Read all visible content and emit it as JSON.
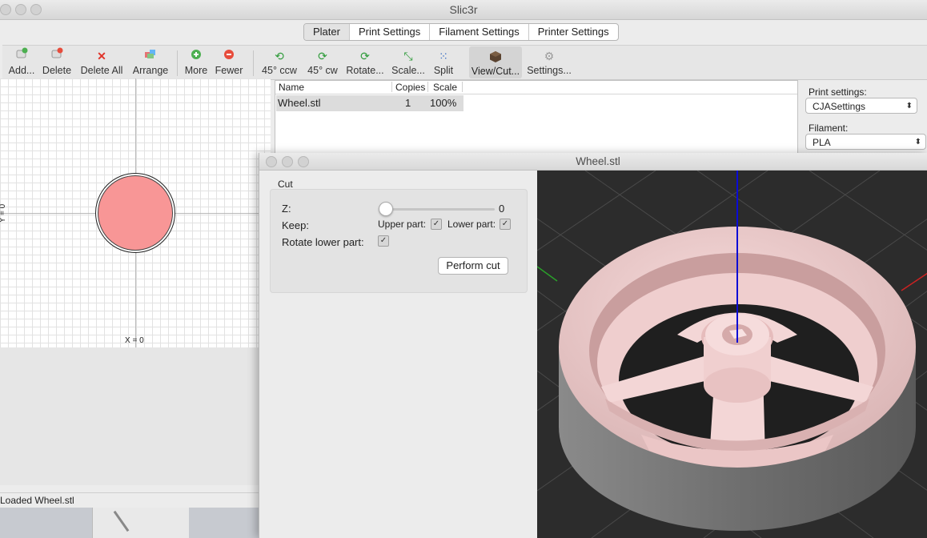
{
  "app": {
    "title": "Slic3r"
  },
  "tabs": [
    "Plater",
    "Print Settings",
    "Filament Settings",
    "Printer Settings"
  ],
  "toolbar": {
    "add": "Add...",
    "delete": "Delete",
    "delete_all": "Delete All",
    "arrange": "Arrange",
    "more": "More",
    "fewer": "Fewer",
    "rot_ccw": "45° ccw",
    "rot_cw": "45° cw",
    "rotate": "Rotate...",
    "scale": "Scale...",
    "split": "Split",
    "view_cut": "View/Cut...",
    "settings": "Settings..."
  },
  "plater": {
    "y_label": "Y = 0",
    "x_label": "X = 0"
  },
  "objects": {
    "headers": {
      "name": "Name",
      "copies": "Copies",
      "scale": "Scale"
    },
    "rows": [
      {
        "name": "Wheel.stl",
        "copies": "1",
        "scale": "100%"
      }
    ]
  },
  "settings": {
    "print_label": "Print settings:",
    "print_value": "CJASettings",
    "filament_label": "Filament:",
    "filament_value": "PLA"
  },
  "status": {
    "text": "Loaded Wheel.stl"
  },
  "dialog": {
    "title": "Wheel.stl",
    "group": "Cut",
    "z_label": "Z:",
    "z_value": "0",
    "keep_label": "Keep:",
    "upper_label": "Upper part:",
    "upper_checked": true,
    "lower_label": "Lower part:",
    "lower_checked": true,
    "rotate_label": "Rotate lower part:",
    "rotate_checked": true,
    "perform": "Perform cut"
  },
  "colors": {
    "object_fill": "#f89696",
    "model": "#f0cccc",
    "background_3d": "#2c2c2c"
  }
}
